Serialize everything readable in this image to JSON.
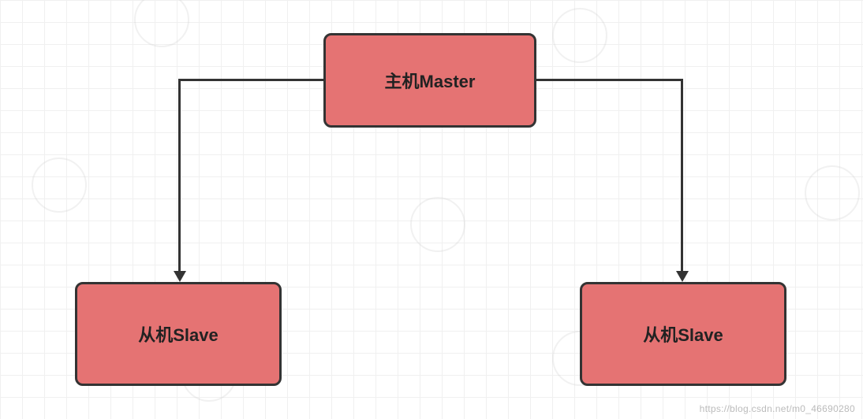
{
  "nodes": {
    "master": {
      "label": "主机Master",
      "fill": "#e57373",
      "stroke": "#333333"
    },
    "slave_left": {
      "label": "从机Slave",
      "fill": "#e57373",
      "stroke": "#333333"
    },
    "slave_right": {
      "label": "从机Slave",
      "fill": "#e57373",
      "stroke": "#333333"
    }
  },
  "edges": [
    {
      "from": "master",
      "to": "slave_left"
    },
    {
      "from": "master",
      "to": "slave_right"
    }
  ],
  "watermark": "https://blog.csdn.net/m0_46690280"
}
